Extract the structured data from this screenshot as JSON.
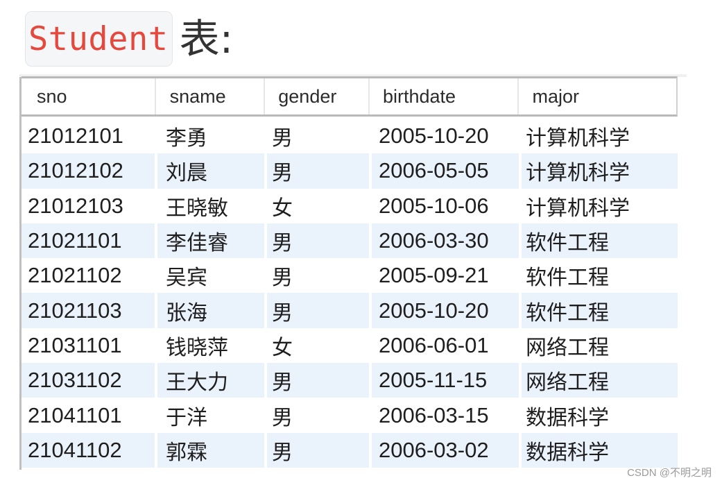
{
  "heading": {
    "code": "Student",
    "suffix": "表:"
  },
  "table": {
    "columns": [
      "sno",
      "sname",
      "gender",
      "birthdate",
      "major"
    ],
    "rows": [
      [
        "21012101",
        "李勇",
        "男",
        "2005-10-20",
        "计算机科学"
      ],
      [
        "21012102",
        "刘晨",
        "男",
        "2006-05-05",
        "计算机科学"
      ],
      [
        "21012103",
        "王晓敏",
        "女",
        "2005-10-06",
        "计算机科学"
      ],
      [
        "21021101",
        "李佳睿",
        "男",
        "2006-03-30",
        "软件工程"
      ],
      [
        "21021102",
        "吴宾",
        "男",
        "2005-09-21",
        "软件工程"
      ],
      [
        "21021103",
        "张海",
        "男",
        "2005-10-20",
        "软件工程"
      ],
      [
        "21031101",
        "钱晓萍",
        "女",
        "2006-06-01",
        "网络工程"
      ],
      [
        "21031102",
        "王大力",
        "男",
        "2005-11-15",
        "网络工程"
      ],
      [
        "21041101",
        "于洋",
        "男",
        "2006-03-15",
        "数据科学"
      ],
      [
        "21041102",
        "郭霖",
        "男",
        "2006-03-02",
        "数据科学"
      ]
    ]
  },
  "watermark": "CSDN @不明之明",
  "colors": {
    "code_text": "#e5483c",
    "alt_row_bg": "#eaf2fc"
  }
}
